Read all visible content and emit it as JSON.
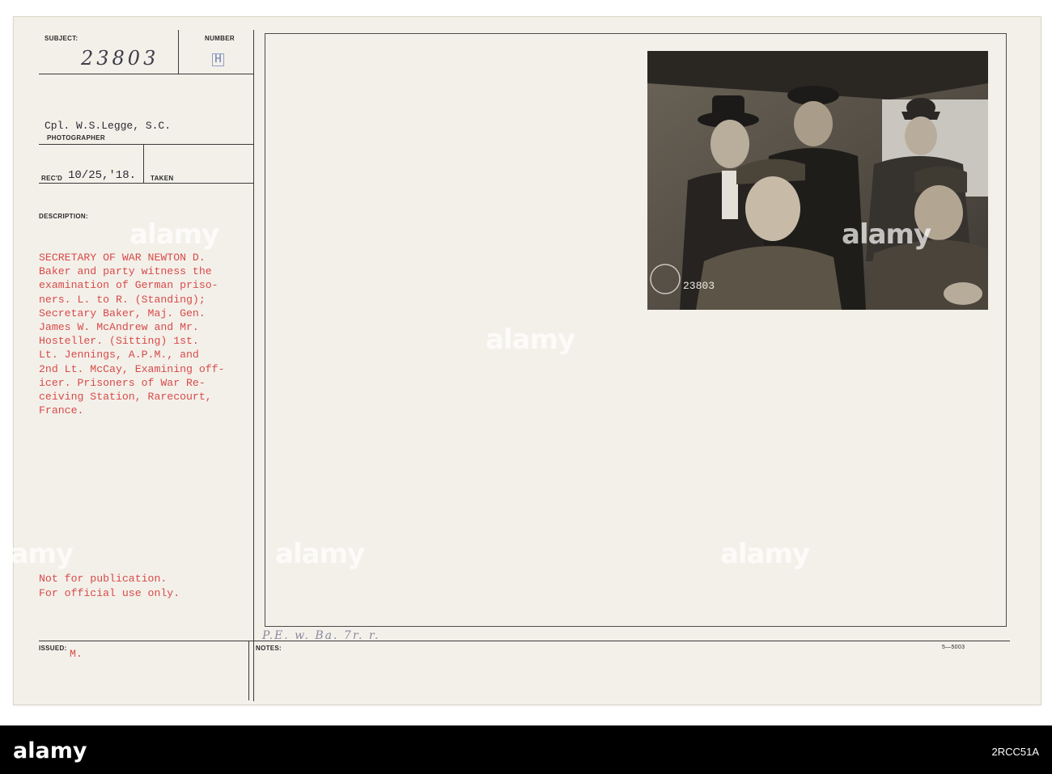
{
  "card": {
    "labels": {
      "subject": "SUBJECT:",
      "number": "NUMBER",
      "photographer": "PHOTOGRAPHER",
      "recd": "REC'D",
      "taken": "TAKEN",
      "description": "DESCRIPTION:",
      "issued": "ISSUED:",
      "notes": "NOTES:"
    },
    "subject_number": "23803",
    "number_mark": "H",
    "photographer_name": "Cpl. W.S.Legge, S.C.",
    "recd_date": "10/25,'18.",
    "description_lines": [
      "SECRETARY OF WAR NEWTON D.",
      "Baker and party witness the",
      "examination of German prisо-",
      "ners. L. to R. (Standing);",
      "Secretary Baker, Maj. Gen.",
      "James W. McAndrew and Mr.",
      "Hosteller. (Sitting) 1st.",
      "Lt. Jennings, A.P.M., and",
      "2nd Lt. McCay, Examining off-",
      "icer. Prisoners of War Re-",
      "ceiving Station, Rarecourt,",
      "France."
    ],
    "restriction_lines": [
      "Not for publication.",
      "For official use only."
    ],
    "issued_value": "M.",
    "notes_handwriting": "P.E. w. Ba. 7r. r.",
    "form_number": "5—5003"
  },
  "photo": {
    "stamp_text": "23803"
  },
  "watermarks": [
    "alamy",
    "alamy",
    "alamy",
    "alamy",
    "alamy",
    "alamy"
  ],
  "footer": {
    "logo": "alamy",
    "image_id": "2RCC51A"
  }
}
